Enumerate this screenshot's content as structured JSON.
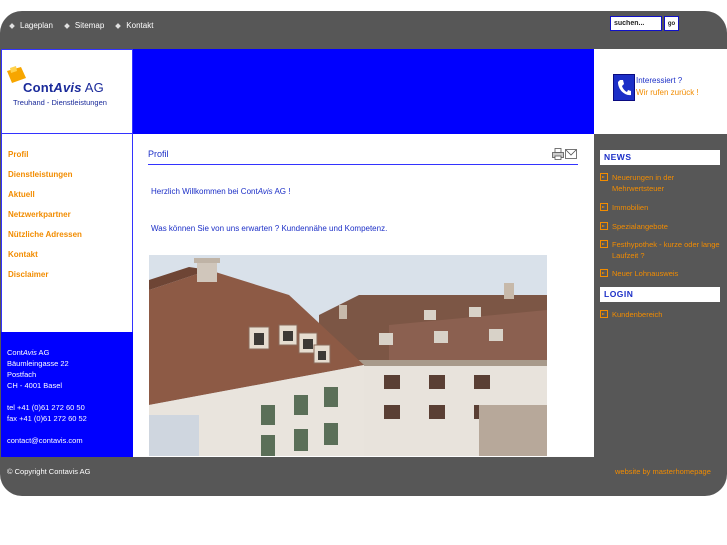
{
  "topnav": {
    "items": [
      {
        "label": "Lageplan"
      },
      {
        "label": "Sitemap"
      },
      {
        "label": "Kontakt"
      }
    ]
  },
  "search": {
    "value": "suchen...",
    "button_label": "go"
  },
  "logo": {
    "name_bold": "Cont",
    "name_italic": "Avis",
    "name_suffix": " AG",
    "tagline": "Treuhand - Dienstleistungen"
  },
  "callback": {
    "question": "Interessiert ?",
    "action": "Wir rufen zurück !",
    "icon": "phone-icon"
  },
  "sidenav": {
    "items": [
      {
        "label": "Profil"
      },
      {
        "label": "Dienstleistungen"
      },
      {
        "label": "Aktuell"
      },
      {
        "label": "Netzwerkpartner"
      },
      {
        "label": "Nützliche Adressen"
      },
      {
        "label": "Kontakt"
      },
      {
        "label": "Disclaimer"
      }
    ]
  },
  "address": {
    "company_prefix": "Cont",
    "company_italic": "Avis",
    "company_suffix": " AG",
    "street": "Bäumleingasse 22",
    "po": "Postfach",
    "city": "CH - 4001 Basel",
    "tel": "tel  +41 (0)61 272 60 50",
    "fax": "fax  +41 (0)61 272 60 52",
    "email": "contact@contavis.com"
  },
  "main": {
    "title": "Profil",
    "welcome_prefix": "Herzlich Willkommen bei Cont",
    "welcome_italic": "Avis",
    "welcome_suffix": " AG !",
    "expect": "Was können Sie von uns erwarten ? Kundennähe und Kompetenz."
  },
  "news": {
    "heading": "NEWS",
    "items": [
      {
        "label": "Neuerungen in der Mehrwertsteuer"
      },
      {
        "label": "Immobilien"
      },
      {
        "label": "Spezialangebote"
      },
      {
        "label": "Festhypothek - kurze oder lange Laufzeit ?"
      },
      {
        "label": "Neuer Lohnausweis"
      }
    ]
  },
  "login": {
    "heading": "LOGIN",
    "items": [
      {
        "label": "Kundenbereich"
      }
    ]
  },
  "footer": {
    "copyright": "© Copyright Contavis AG",
    "credit": "website by masterhomepage"
  },
  "colors": {
    "accent_blue": "#0000ff",
    "link_orange": "#f28c00",
    "frame_gray": "#575757"
  }
}
